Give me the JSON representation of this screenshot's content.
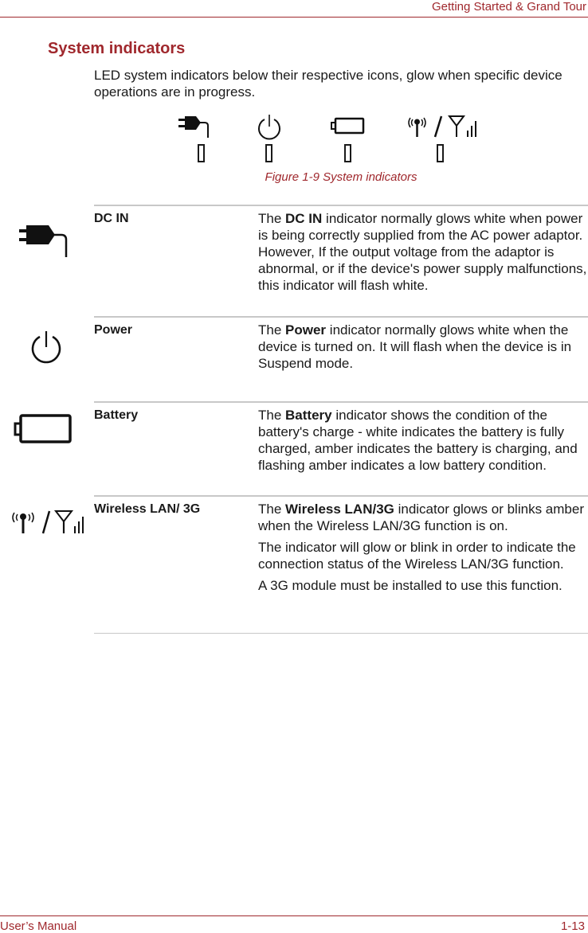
{
  "header": {
    "chapter": "Getting Started & Grand Tour"
  },
  "section": {
    "title": "System indicators",
    "intro": "LED system indicators below their respective icons, glow when specific device operations are in progress."
  },
  "figure": {
    "caption": "Figure 1-9 System indicators",
    "icons": [
      "dc-in-plug-icon",
      "power-icon",
      "battery-icon",
      "wireless-3g-icon"
    ]
  },
  "indicators": [
    {
      "label": "DC IN",
      "icon": "dc-in-plug-icon",
      "paragraphs": [
        {
          "pre": "The ",
          "bold": "DC IN",
          "post": " indicator normally glows white when power is being correctly supplied from the AC power adaptor. However, If the output voltage from the adaptor is abnormal, or if the device's power supply malfunctions, this indicator will flash white."
        }
      ]
    },
    {
      "label": "Power",
      "icon": "power-icon",
      "paragraphs": [
        {
          "pre": "The ",
          "bold": "Power",
          "post": " indicator normally glows white when the device is turned on. It will flash when the device is in Suspend mode."
        }
      ]
    },
    {
      "label": "Battery",
      "icon": "battery-icon",
      "paragraphs": [
        {
          "pre": "The ",
          "bold": "Battery",
          "post": " indicator shows the condition of the battery's charge - white indicates the battery is fully charged, amber indicates the battery is charging, and flashing amber indicates a low battery condition."
        }
      ]
    },
    {
      "label": "Wireless LAN/ 3G",
      "icon": "wireless-3g-icon",
      "paragraphs": [
        {
          "pre": "The ",
          "bold": "Wireless LAN/3G",
          "post": " indicator glows or blinks amber when the Wireless LAN/3G function is on."
        },
        {
          "pre": "The indicator will glow or blink in order to indicate the connection status of the Wireless LAN/3G function.",
          "bold": "",
          "post": ""
        },
        {
          "pre": "A 3G module must be installed to use this function.",
          "bold": "",
          "post": ""
        }
      ]
    }
  ],
  "footer": {
    "left": "User’s Manual",
    "right": "1-13"
  },
  "colors": {
    "accent": "#a0282d",
    "rule": "#c8c8c8",
    "text": "#1a1a1a"
  }
}
